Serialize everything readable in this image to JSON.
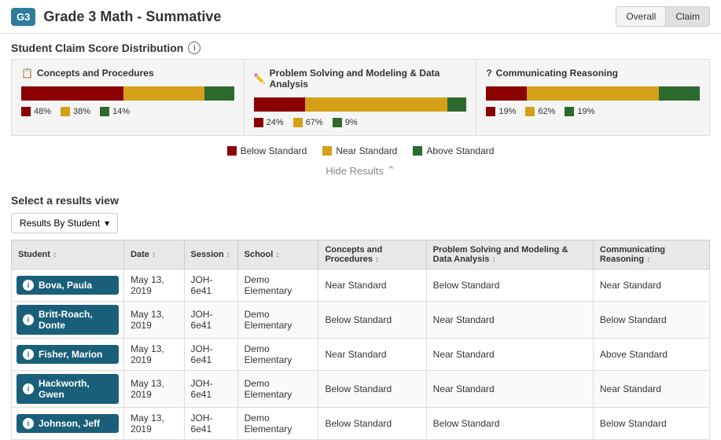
{
  "header": {
    "badge": "G3",
    "title": "Grade 3 Math - Summative",
    "btn_overall": "Overall",
    "btn_claim": "Claim"
  },
  "section_title": "Student Claim Score Distribution",
  "claims": [
    {
      "icon": "📋",
      "title": "Concepts and Procedures",
      "bars": [
        {
          "color": "#8b0000",
          "pct": 48,
          "label": "48%"
        },
        {
          "color": "#d4a017",
          "pct": 38,
          "label": "38%"
        },
        {
          "color": "#2d6a2d",
          "pct": 14,
          "label": "14%"
        }
      ]
    },
    {
      "icon": "✏️",
      "title": "Problem Solving and Modeling & Data Analysis",
      "bars": [
        {
          "color": "#8b0000",
          "pct": 24,
          "label": "24%"
        },
        {
          "color": "#d4a017",
          "pct": 67,
          "label": "67%"
        },
        {
          "color": "#2d6a2d",
          "pct": 9,
          "label": "9%"
        }
      ]
    },
    {
      "icon": "?",
      "title": "Communicating Reasoning",
      "bars": [
        {
          "color": "#8b0000",
          "pct": 19,
          "label": "19%"
        },
        {
          "color": "#d4a017",
          "pct": 62,
          "label": "62%"
        },
        {
          "color": "#2d6a2d",
          "pct": 19,
          "label": "19%"
        }
      ]
    }
  ],
  "legend": {
    "below": {
      "color": "#8b0000",
      "label": "Below Standard"
    },
    "near": {
      "color": "#d4a017",
      "label": "Near Standard"
    },
    "above": {
      "color": "#2d6a2d",
      "label": "Above Standard"
    }
  },
  "hide_results_label": "Hide Results",
  "results_view_label": "Select a results view",
  "dropdown_label": "Results By Student",
  "table": {
    "columns": [
      {
        "key": "student",
        "label": "Student"
      },
      {
        "key": "date",
        "label": "Date"
      },
      {
        "key": "session",
        "label": "Session"
      },
      {
        "key": "school",
        "label": "School"
      },
      {
        "key": "concepts",
        "label": "Concepts and Procedures"
      },
      {
        "key": "problem_solving",
        "label": "Problem Solving and Modeling & Data Analysis"
      },
      {
        "key": "communicating",
        "label": "Communicating Reasoning"
      }
    ],
    "rows": [
      {
        "student": "Bova, Paula",
        "date": "May 13, 2019",
        "session": "JOH-6e41",
        "school": "Demo Elementary",
        "concepts": "Near Standard",
        "problem_solving": "Below Standard",
        "communicating": "Near Standard"
      },
      {
        "student": "Britt-Roach, Donte",
        "date": "May 13, 2019",
        "session": "JOH-6e41",
        "school": "Demo Elementary",
        "concepts": "Below Standard",
        "problem_solving": "Near Standard",
        "communicating": "Below Standard"
      },
      {
        "student": "Fisher, Marion",
        "date": "May 13, 2019",
        "session": "JOH-6e41",
        "school": "Demo Elementary",
        "concepts": "Near Standard",
        "problem_solving": "Near Standard",
        "communicating": "Above Standard"
      },
      {
        "student": "Hackworth, Gwen",
        "date": "May 13, 2019",
        "session": "JOH-6e41",
        "school": "Demo Elementary",
        "concepts": "Below Standard",
        "problem_solving": "Near Standard",
        "communicating": "Near Standard"
      },
      {
        "student": "Johnson, Jeff",
        "date": "May 13, 2019",
        "session": "JOH-6e41",
        "school": "Demo Elementary",
        "concepts": "Below Standard",
        "problem_solving": "Below Standard",
        "communicating": "Below Standard"
      }
    ]
  }
}
